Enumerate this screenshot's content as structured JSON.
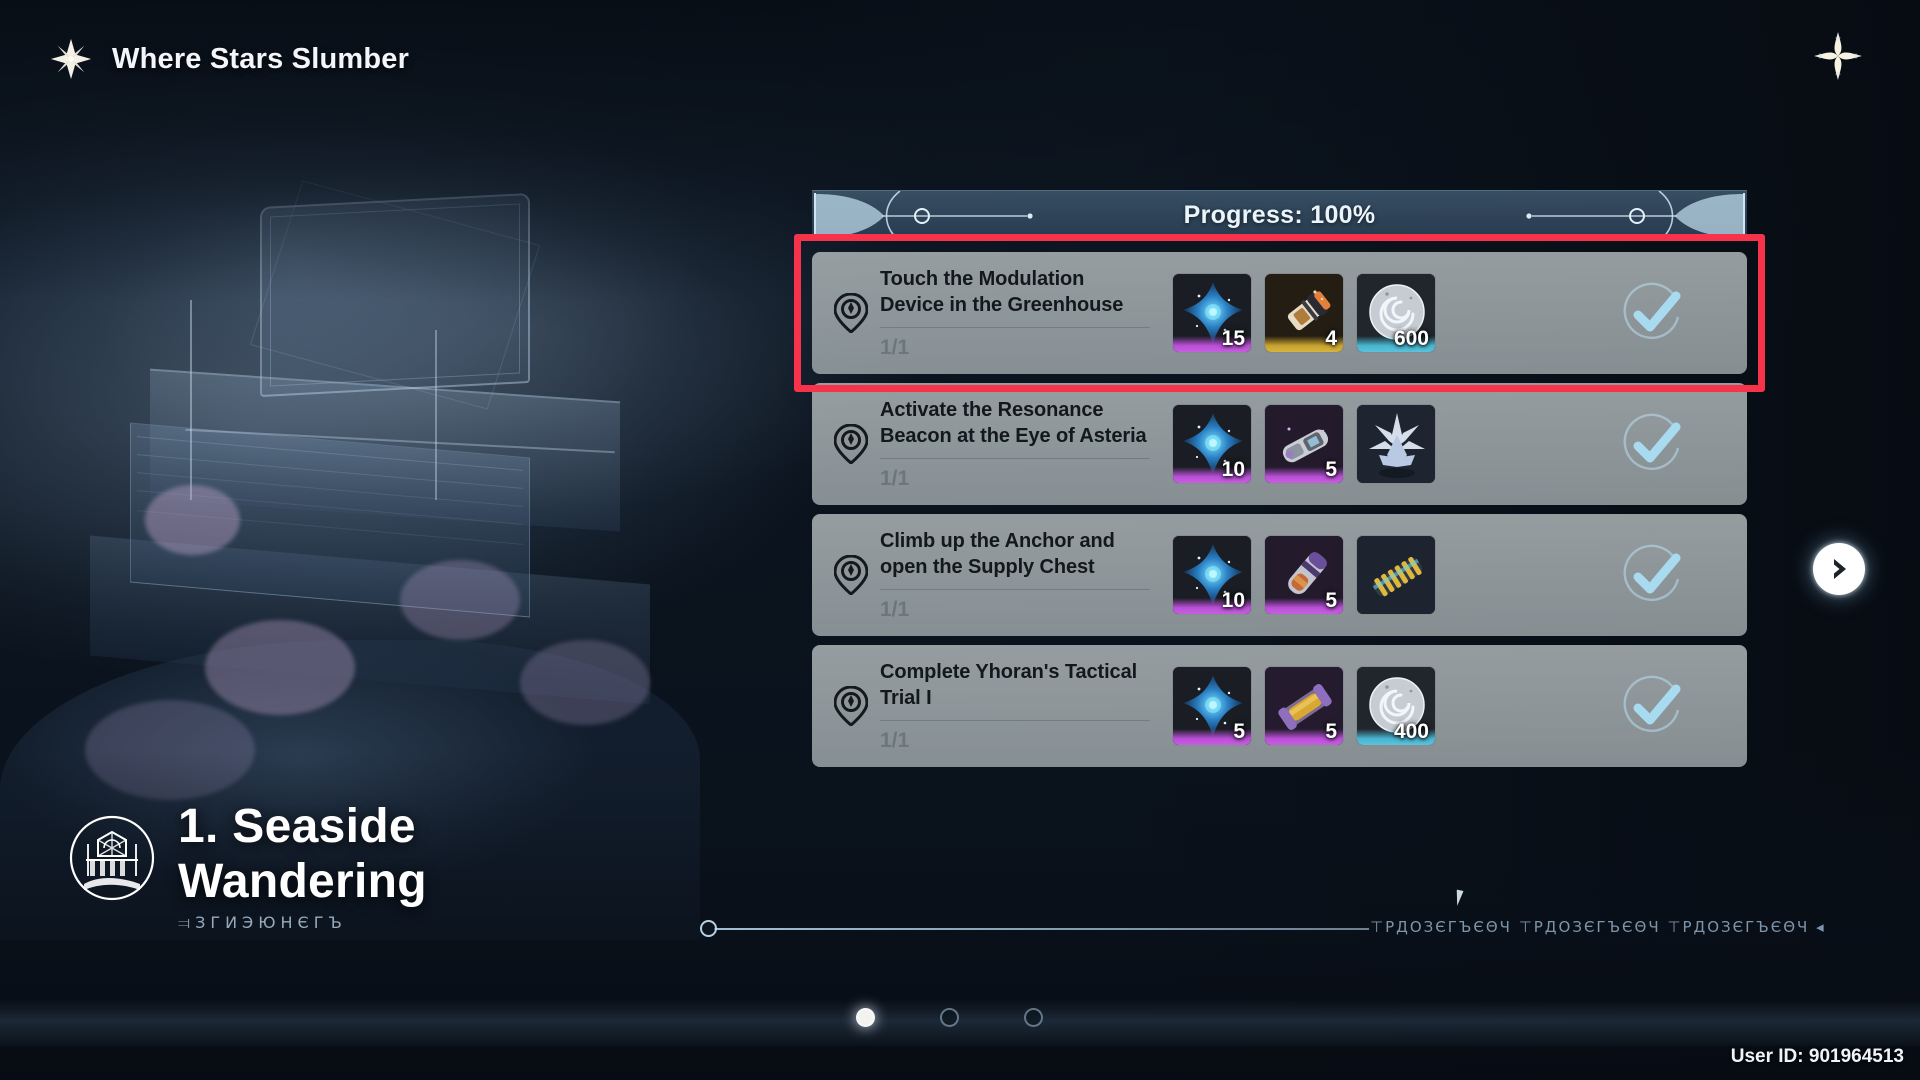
{
  "header": {
    "title": "Where Stars Slumber",
    "star_icon": "star-burst-icon",
    "close_icon": "close-star-icon"
  },
  "progress": {
    "label": "Progress: 100%",
    "percent": 100
  },
  "tasks": [
    {
      "title": "Touch the Modulation Device in the Greenhouse",
      "count": "1/1",
      "completed": true,
      "highlighted": true,
      "icon": "location-pin-icon",
      "status_icon": "check-circle-icon",
      "rewards": [
        {
          "item": "astral-shard",
          "qty": "15",
          "rarity": "purple"
        },
        {
          "item": "energy-canister",
          "qty": "4",
          "rarity": "gold"
        },
        {
          "item": "spiral-shell-currency",
          "qty": "600",
          "rarity": "blue"
        }
      ]
    },
    {
      "title": "Activate the Resonance Beacon at the Eye of Asteria",
      "count": "1/1",
      "completed": true,
      "highlighted": false,
      "icon": "location-pin-icon",
      "status_icon": "check-circle-icon",
      "rewards": [
        {
          "item": "astral-shard",
          "qty": "10",
          "rarity": "purple"
        },
        {
          "item": "tech-cylinder",
          "qty": "5",
          "rarity": "purple"
        },
        {
          "item": "crystal-bloom",
          "qty": "",
          "rarity": "none"
        }
      ]
    },
    {
      "title": "Climb up the Anchor and open the Supply Chest",
      "count": "1/1",
      "completed": true,
      "highlighted": false,
      "icon": "location-pin-icon",
      "status_icon": "check-circle-icon",
      "rewards": [
        {
          "item": "astral-shard",
          "qty": "10",
          "rarity": "purple"
        },
        {
          "item": "violet-vial",
          "qty": "5",
          "rarity": "purple"
        },
        {
          "item": "gold-coil",
          "qty": "",
          "rarity": "none"
        }
      ]
    },
    {
      "title": "Complete Yhoran's Tactical Trial I",
      "count": "1/1",
      "completed": true,
      "highlighted": false,
      "icon": "location-pin-icon",
      "status_icon": "check-circle-icon",
      "rewards": [
        {
          "item": "astral-shard",
          "qty": "5",
          "rarity": "purple"
        },
        {
          "item": "amber-capsule",
          "qty": "5",
          "rarity": "purple"
        },
        {
          "item": "spiral-shell-currency",
          "qty": "400",
          "rarity": "blue"
        }
      ]
    }
  ],
  "chapter": {
    "title": "1. Seaside Wandering",
    "runes": "⫤ЗГИЭЮНЄГЪ",
    "emblem": "observatory-emblem"
  },
  "timeline": {
    "runes": "⊤РДОЗЄГЪЄΘЧ ⊤РДОЗЄГЪЄΘЧ ⊤РДОЗЄГЪЄΘЧ ◂"
  },
  "pagination": {
    "total": 3,
    "active_index": 0
  },
  "nav": {
    "next_icon": "chevron-right-icon"
  },
  "footer": {
    "user_id": "User ID: 901964513"
  },
  "colors": {
    "highlight_box": "#f7334c",
    "check_blue": "#a8daf0",
    "panel_gray": "#a8b0b2",
    "progress_bg": "#3e566c"
  }
}
